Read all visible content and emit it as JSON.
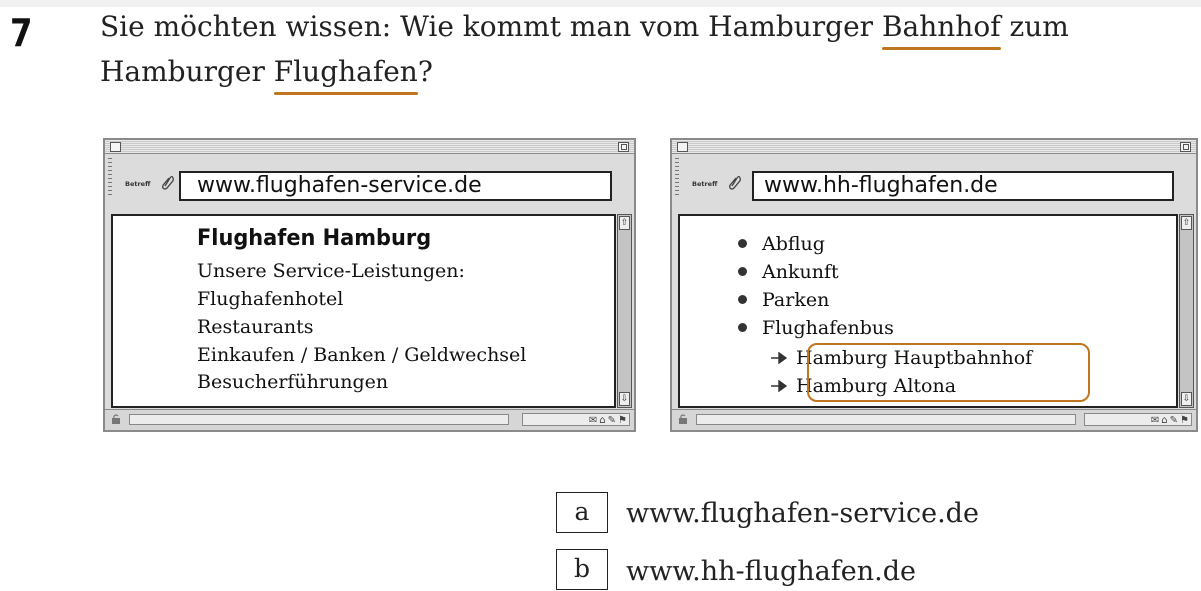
{
  "question": {
    "number": "7",
    "line1_before": "Sie möchten wissen: Wie kommt man vom Hamburger ",
    "line1_underlined": "Bahnhof",
    "line1_after": " zum",
    "line2_before": "Hamburger ",
    "line2_underlined": "Flughafen",
    "line2_after": "?"
  },
  "colors": {
    "accent": "#c0761f",
    "window_chrome": "#dcdcdc"
  },
  "browser_left": {
    "address_label": "Betreff",
    "url": "www.flughafen-service.de",
    "page_title": "Flughafen Hamburg",
    "lines": [
      "Unsere Service-Leistungen:",
      "Flughafenhotel",
      "Restaurants",
      "Einkaufen / Banken / Geldwechsel",
      "Besucherführungen"
    ]
  },
  "browser_right": {
    "address_label": "Betreff",
    "url": "www.hh-flughafen.de",
    "menu": [
      "Abflug",
      "Ankunft",
      "Parken",
      "Flughafenbus"
    ],
    "sub_items": [
      "Hamburg Hauptbahnhof",
      "Hamburg Altona"
    ]
  },
  "options": [
    {
      "letter": "a",
      "text": "www.flughafen-service.de"
    },
    {
      "letter": "b",
      "text": "www.hh-flughafen.de"
    }
  ]
}
